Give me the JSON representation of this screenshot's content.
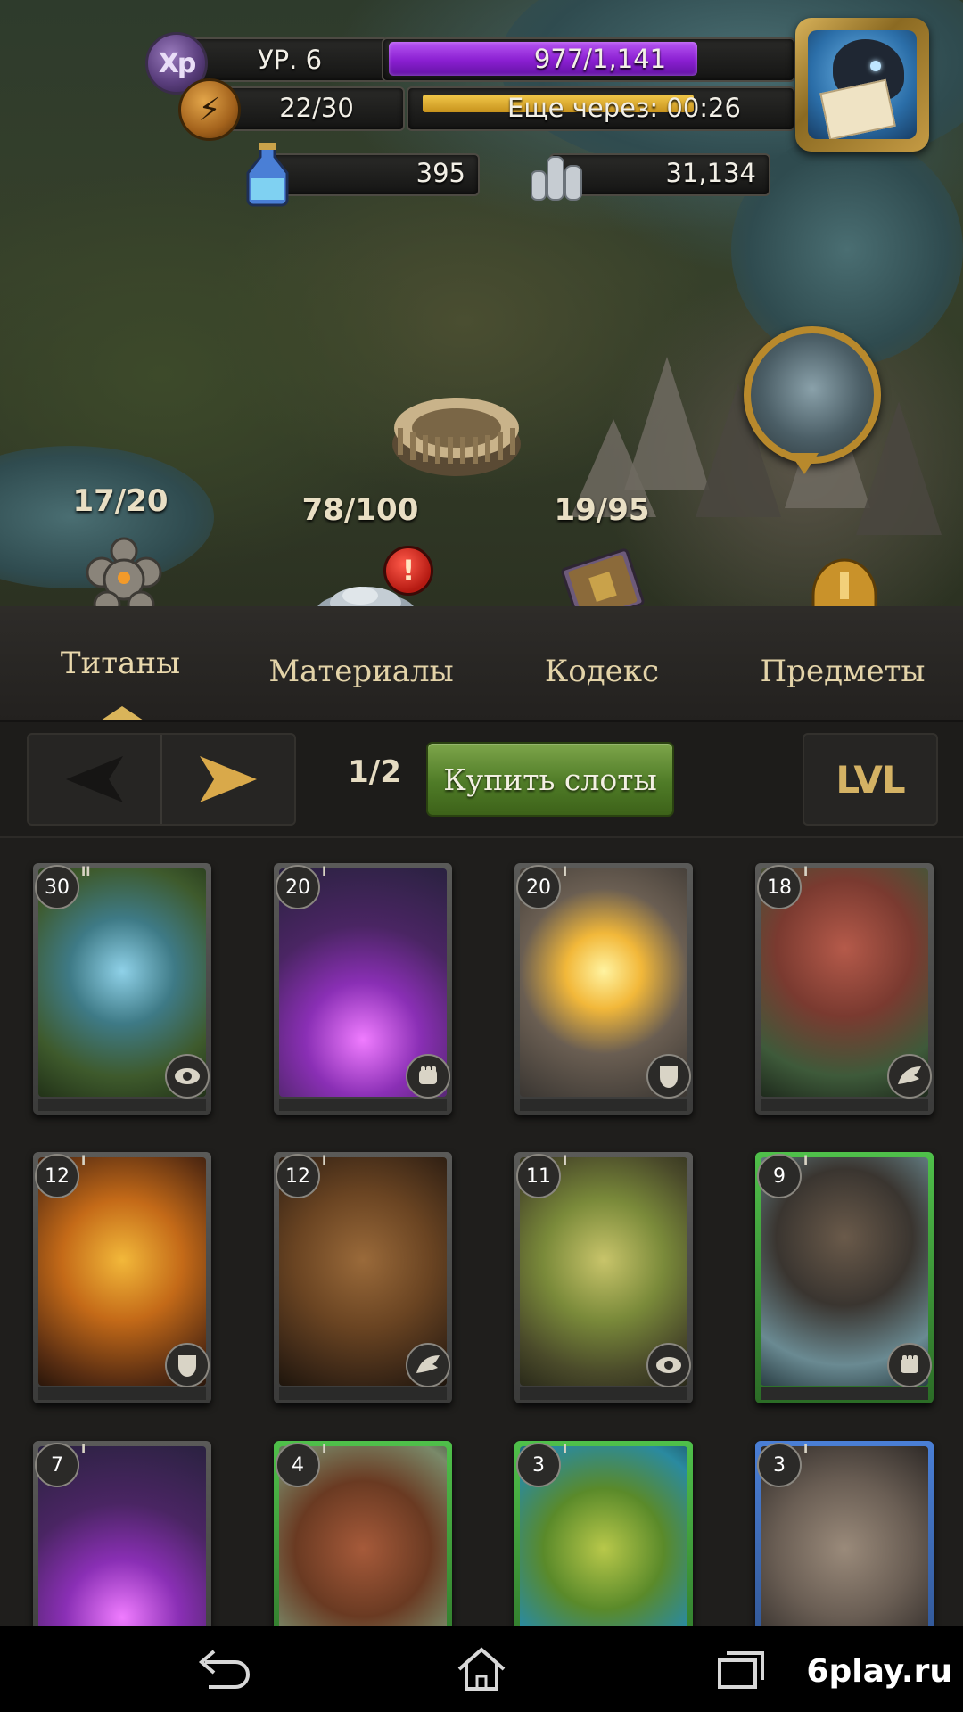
{
  "hud": {
    "level_label": "УР. 6",
    "xp_text": "977/1,141",
    "xp_fraction": 0.856,
    "energy_text": "22/30",
    "energy_timer": "Еще через: 00:26",
    "energy_fraction": 0.8,
    "gems": "395",
    "silver": "31,134",
    "xp_badge": "Xp"
  },
  "map": {
    "counters": {
      "titans": "17/20",
      "materials": "78/100",
      "codex": "19/95"
    },
    "materials_alert": "!"
  },
  "tabs": [
    {
      "label": "Титаны",
      "active": true
    },
    {
      "label": "Материалы",
      "active": false
    },
    {
      "label": "Кодекс",
      "active": false
    },
    {
      "label": "Предметы",
      "active": false
    }
  ],
  "toolbar": {
    "page": "1/2",
    "buy_slots": "Купить слоты",
    "lvl": "LVL"
  },
  "cards": [
    {
      "level": "30",
      "tier": "II",
      "role": "eye",
      "rarity": "gray",
      "art": "forest"
    },
    {
      "level": "20",
      "tier": "I",
      "role": "fist",
      "rarity": "gray",
      "art": "crystal"
    },
    {
      "level": "20",
      "tier": "I",
      "role": "shield",
      "rarity": "gray",
      "art": "fire"
    },
    {
      "level": "18",
      "tier": "I",
      "role": "wing",
      "rarity": "gray",
      "art": "mushroom"
    },
    {
      "level": "12",
      "tier": "I",
      "role": "shield",
      "rarity": "gray",
      "art": "amber"
    },
    {
      "level": "12",
      "tier": "I",
      "role": "wing",
      "rarity": "gray",
      "art": "bark"
    },
    {
      "level": "11",
      "tier": "I",
      "role": "eye",
      "rarity": "gray",
      "art": "feather"
    },
    {
      "level": "9",
      "tier": "I",
      "role": "fist",
      "rarity": "green",
      "art": "ship"
    },
    {
      "level": "7",
      "tier": "I",
      "role": "",
      "rarity": "gray",
      "art": "crystal"
    },
    {
      "level": "4",
      "tier": "I",
      "role": "",
      "rarity": "green",
      "art": "beast"
    },
    {
      "level": "3",
      "tier": "I",
      "role": "",
      "rarity": "green",
      "art": "leaf"
    },
    {
      "level": "3",
      "tier": "I",
      "role": "",
      "rarity": "blue",
      "art": "stone"
    }
  ],
  "watermark": "6play.ru"
}
